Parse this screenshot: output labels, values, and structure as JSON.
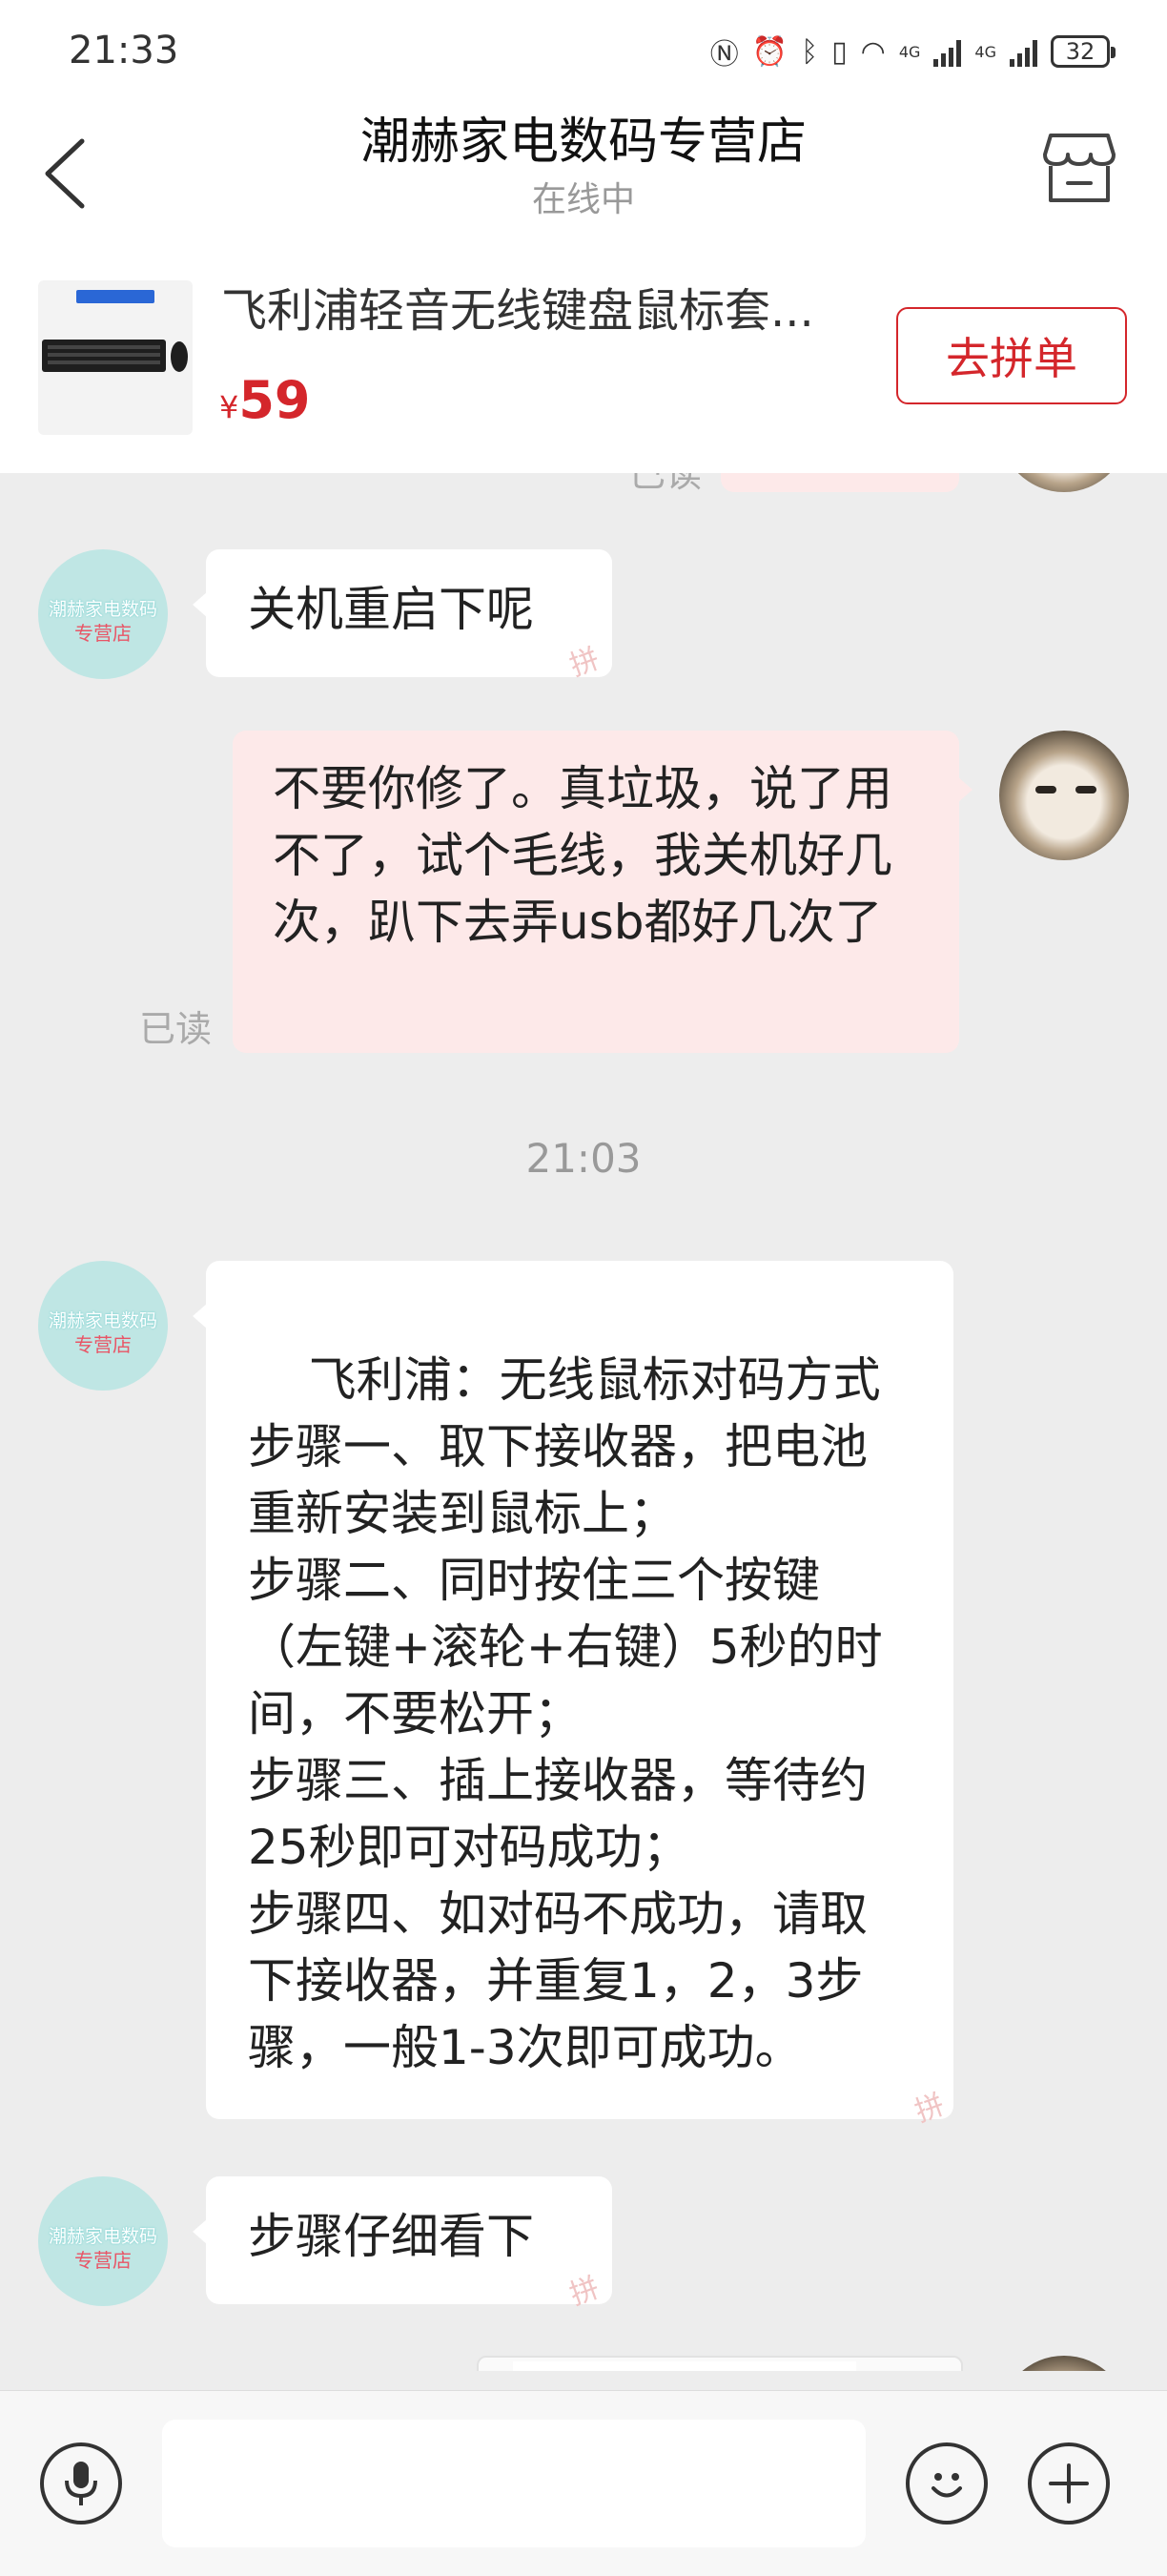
{
  "status_bar": {
    "time": "21:33",
    "battery": "32",
    "network_label": "4G"
  },
  "header": {
    "title": "潮赫家电数码专营店",
    "subtitle": "在线中"
  },
  "product": {
    "title": "飞利浦轻音无线键盘鼠标套...",
    "currency": "¥",
    "price": "59",
    "button_label": "去拼单"
  },
  "store_avatar": {
    "line1": "潮赫家电数码",
    "line2": "专营店"
  },
  "messages": {
    "partial_read": "已读",
    "m1": "关机重启下呢",
    "m2": "不要你修了。真垃圾，说了用不了，试个毛线，我关机好几次，趴下去弄usb都好几次了",
    "m2_read": "已读",
    "timestamp": "21:03",
    "m3": "飞利浦：无线鼠标对码方式\n步骤一、取下接收器，把电池重新安装到鼠标上；\n步骤二、同时按住三个按键（左键+滚轮+右键）5秒的时间，不要松开；\n步骤三、插上接收器，等待约25秒即可对码成功；\n步骤四、如对码不成功，请取下接收器，并重复1，2，3步骤，一般1-3次即可成功。",
    "m4": "步骤仔细看下"
  },
  "icons": {
    "back": "chevron-left-icon",
    "store": "storefront-icon",
    "voice": "microphone-icon",
    "emoji": "smiley-icon",
    "more": "plus-icon"
  },
  "colors": {
    "accent": "#d4262b",
    "outgoing_bubble": "#fde9e9",
    "background": "#ededed"
  }
}
